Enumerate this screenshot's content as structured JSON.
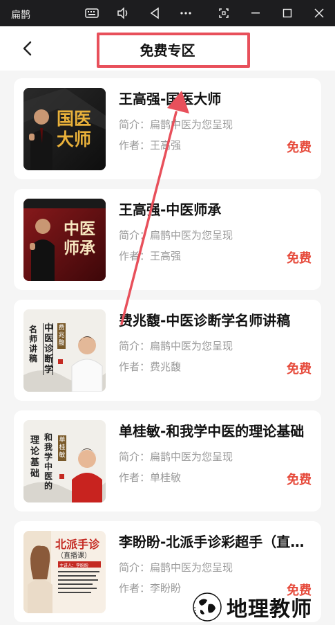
{
  "window": {
    "app_title": "扁鹊"
  },
  "header": {
    "title": "免费专区"
  },
  "cards": [
    {
      "title": "王高强-国医大师",
      "intro": "简介：扁鹊中医为您呈现",
      "author": "作者：王高强",
      "price": "免费",
      "thumb_text": "国医大师"
    },
    {
      "title": "王高强-中医师承",
      "intro": "简介：扁鹊中医为您呈现",
      "author": "作者：王高强",
      "price": "免费",
      "thumb_text": "中医师承"
    },
    {
      "title": "费兆馥-中医诊断学名师讲稿",
      "intro": "简介：扁鹊中医为您呈现",
      "author": "作者：费兆馥",
      "price": "免费",
      "thumb_text_a": "名师讲稿",
      "thumb_text_b": "中医诊断学",
      "thumb_text_c": "费兆馥"
    },
    {
      "title": "单桂敏-和我学中医的理论基础",
      "intro": "简介：扁鹊中医为您呈现",
      "author": "作者：单桂敏",
      "price": "免费",
      "thumb_text_a": "理论基础",
      "thumb_text_b": "和我学中医的",
      "thumb_text_c": "单桂敏"
    },
    {
      "title": "李盼盼-北派手诊彩超手（直播课）",
      "intro": "简介：扁鹊中医为您呈现",
      "author": "作者：李盼盼",
      "price": "免费",
      "thumb_text_a": "北派手诊",
      "thumb_text_b": "（直播课）",
      "thumb_text_c": "主讲人：李盼盼"
    }
  ],
  "watermark": {
    "text": "地理教师"
  },
  "colors": {
    "accent_red": "#e64a3b",
    "annotation": "#e8505b"
  }
}
